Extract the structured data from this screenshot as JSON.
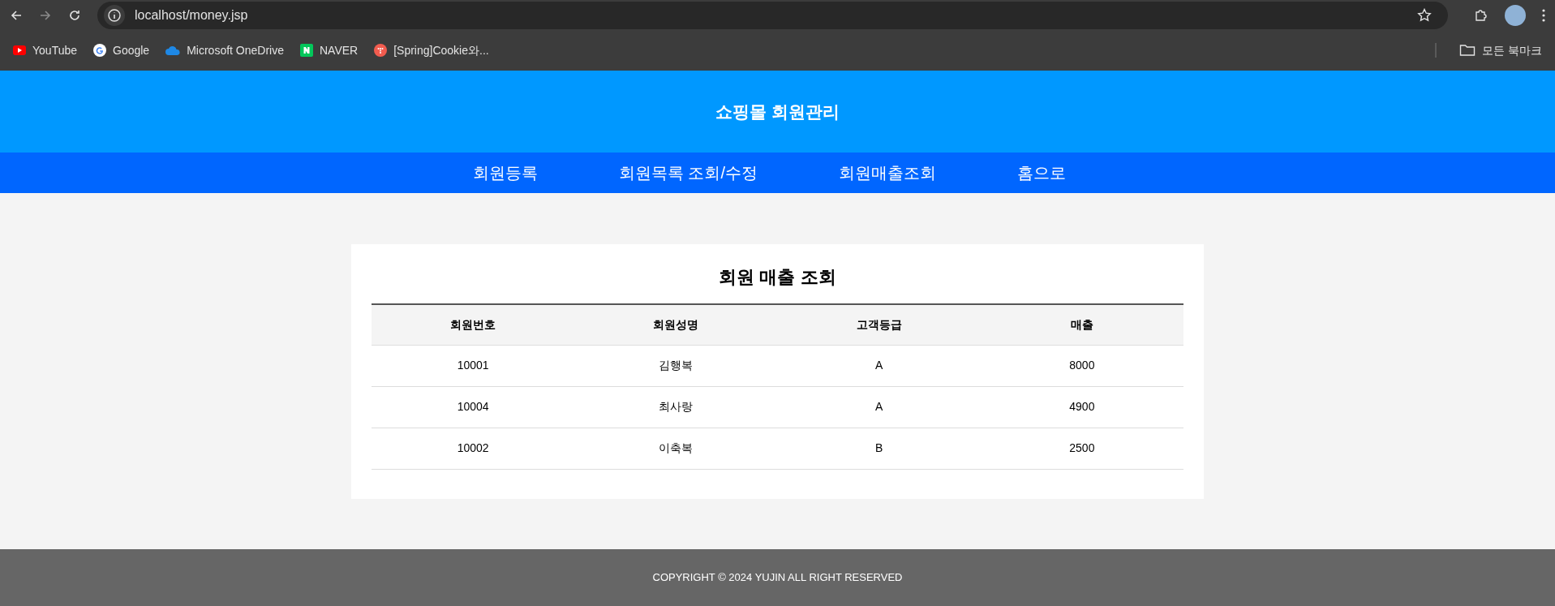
{
  "browser": {
    "url": "localhost/money.jsp",
    "bookmarks": [
      {
        "label": "YouTube"
      },
      {
        "label": "Google"
      },
      {
        "label": "Microsoft OneDrive"
      },
      {
        "label": "NAVER"
      },
      {
        "label": "[Spring]Cookie와..."
      }
    ],
    "all_bookmarks": "모든 북마크"
  },
  "header": {
    "title": "쇼핑몰 회원관리"
  },
  "nav": [
    "회원등록",
    "회원목록 조회/수정",
    "회원매출조회",
    "홈으로"
  ],
  "main": {
    "title": "회원 매출 조회",
    "table": {
      "columns": [
        "회원번호",
        "회원성명",
        "고객등급",
        "매출"
      ],
      "rows": [
        [
          "10001",
          "김행복",
          "A",
          "8000"
        ],
        [
          "10004",
          "최사랑",
          "A",
          "4900"
        ],
        [
          "10002",
          "이축복",
          "B",
          "2500"
        ]
      ]
    }
  },
  "footer": "COPYRIGHT © 2024 YUJIN ALL RIGHT RESERVED"
}
